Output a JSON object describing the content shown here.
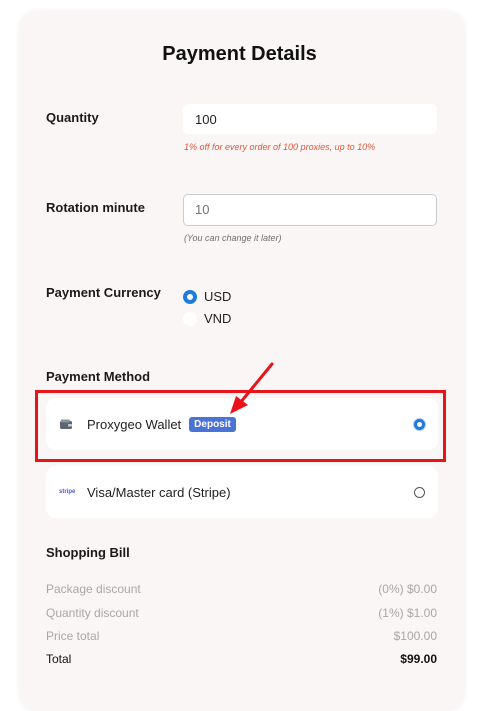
{
  "page": {
    "title": "Payment Details"
  },
  "quantity": {
    "label": "Quantity",
    "value": "100",
    "hint": "1% off for every order of 100 proxies, up to 10%"
  },
  "rotation": {
    "label": "Rotation minute",
    "placeholder": "10",
    "hint": "(You can change it later)"
  },
  "currency": {
    "label": "Payment Currency",
    "options": [
      {
        "label": "USD",
        "selected": true
      },
      {
        "label": "VND",
        "selected": false
      }
    ]
  },
  "payment_method": {
    "label": "Payment Method",
    "methods": [
      {
        "label": "Proxygeo Wallet",
        "badge": "Deposit",
        "selected": true,
        "icon": "wallet-icon"
      },
      {
        "label": "Visa/Master card (Stripe)",
        "selected": false,
        "icon": "stripe-logo-icon",
        "icon_text": "stripe"
      }
    ]
  },
  "bill": {
    "title": "Shopping Bill",
    "rows": [
      {
        "label": "Package discount",
        "value": "(0%) $0.00"
      },
      {
        "label": "Quantity discount",
        "value": "(1%) $1.00"
      },
      {
        "label": "Price total",
        "value": "$100.00"
      }
    ],
    "total": {
      "label": "Total",
      "value": "$99.00"
    }
  },
  "colors": {
    "accent": "#1e7be0",
    "badge": "#4b73d6",
    "hint_red": "#e0573a",
    "annotation_red": "#e8141a"
  }
}
